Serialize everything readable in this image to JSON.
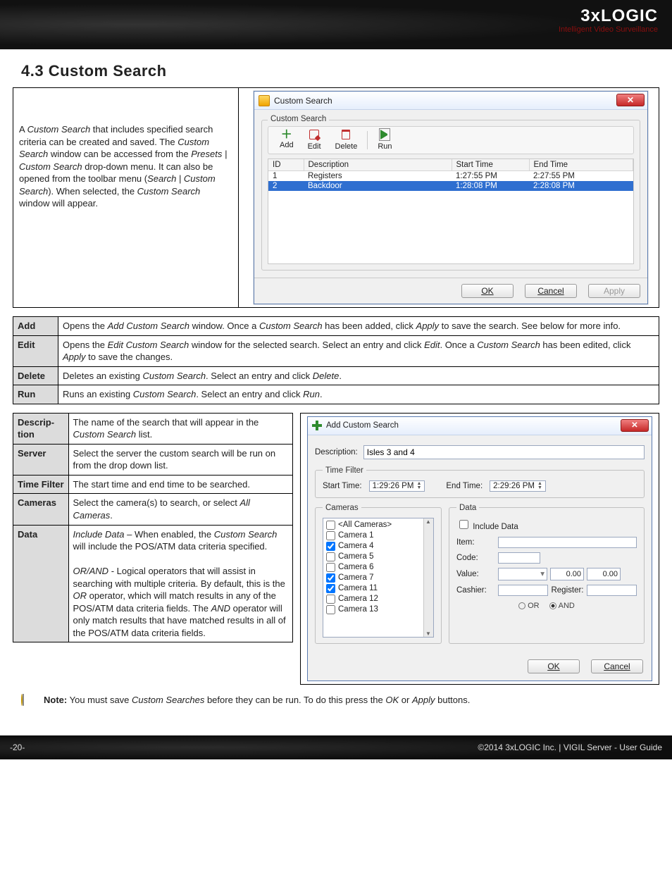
{
  "banner": {
    "logo_top": "3xLOGIC",
    "logo_sub": "Intelligent Video Surveillance"
  },
  "section_heading": "4.3 Custom Search",
  "intro_html": "A <em>Custom Search</em> that includes specified search criteria can be created and saved. The <em>Custom Search</em> window can be accessed from the <em>Presets | Custom Search</em> drop-down menu. It can also be opened from the toolbar menu (<em>Search | Custom Search</em>). When selected, the <em>Custom Search</em> window will appear.",
  "cs_dialog": {
    "title": "Custom Search",
    "group_title": "Custom Search",
    "toolbar": {
      "add": "Add",
      "edit": "Edit",
      "delete": "Delete",
      "run": "Run"
    },
    "grid": {
      "headers": {
        "id": "ID",
        "desc": "Description",
        "start": "Start Time",
        "end": "End Time"
      },
      "rows": [
        {
          "id": "1",
          "desc": "Registers",
          "start": "1:27:55 PM",
          "end": "2:27:55 PM",
          "selected": false
        },
        {
          "id": "2",
          "desc": "Backdoor",
          "start": "1:28:08 PM",
          "end": "2:28:08 PM",
          "selected": true
        }
      ]
    },
    "buttons": {
      "ok": "OK",
      "cancel": "Cancel",
      "apply": "Apply"
    }
  },
  "def1": [
    {
      "k": "Add",
      "v_html": "Opens the <em>Add Custom Search</em> window. Once a <em>Custom Search</em> has been added, click <em>Apply</em> to save the search. See below for more info."
    },
    {
      "k": "Edit",
      "v_html": "Opens the <em>Edit Custom Search</em> window for the selected search. Select an entry and click <em>Edit</em>. Once a <em>Custom Search</em> has been edited, click <em>Apply</em> to save the changes."
    },
    {
      "k": "Delete",
      "v_html": "Deletes an existing <em>Custom Search</em>. Select an entry and click <em>Delete</em>."
    },
    {
      "k": "Run",
      "v_html": "Runs an existing <em>Custom Search</em>. Select an entry and click <em>Run</em>."
    }
  ],
  "def2": [
    {
      "k": "Descrip-tion",
      "v_html": "The name of the search that will appear in the <em>Custom Search</em> list."
    },
    {
      "k": "Server",
      "v_html": "Select the server the custom search will be run on from the drop down list."
    },
    {
      "k": "Time Filter",
      "v_html": "The start time and end time to be searched."
    },
    {
      "k": "Cameras",
      "v_html": "Select the camera(s) to search, or select <em>All Cameras</em>."
    },
    {
      "k": "Data",
      "v_html": "<em>Include Data</em> – When enabled, the <em>Custom Search</em> will include the POS/ATM data criteria specified.<br><br><em>OR/AND</em> - Logical operators that will assist in searching with multiple criteria. By default, this is the <em>OR</em> operator, which will match results in any of the POS/ATM data criteria fields. The <em>AND</em> operator will only match results that have matched results in all of the POS/ATM data criteria fields."
    }
  ],
  "acs": {
    "title": "Add Custom Search",
    "desc_label": "Description:",
    "desc_value": "Isles 3 and 4",
    "timefilter": {
      "legend": "Time Filter",
      "start_label": "Start Time:",
      "start_val": "1:29:26 PM",
      "end_label": "End Time:",
      "end_val": "2:29:26 PM"
    },
    "cameras": {
      "legend": "Cameras",
      "items": [
        {
          "label": "<All Cameras>",
          "checked": false
        },
        {
          "label": "Camera 1",
          "checked": false
        },
        {
          "label": "Camera 4",
          "checked": true
        },
        {
          "label": "Camera 5",
          "checked": false
        },
        {
          "label": "Camera 6",
          "checked": false
        },
        {
          "label": "Camera 7",
          "checked": true
        },
        {
          "label": "Camera 11",
          "checked": true
        },
        {
          "label": "Camera 12",
          "checked": false
        },
        {
          "label": "Camera 13",
          "checked": false
        }
      ]
    },
    "data": {
      "legend": "Data",
      "include_label": "Include Data",
      "include_checked": false,
      "item_label": "Item:",
      "item_val": "",
      "code_label": "Code:",
      "code_val": "",
      "value_label": "Value:",
      "value_lo": "0.00",
      "value_hi": "0.00",
      "cashier_label": "Cashier:",
      "cashier_val": "",
      "register_label": "Register:",
      "register_val": "",
      "or_label": "OR",
      "and_label": "AND",
      "selected": "AND"
    },
    "buttons": {
      "ok": "OK",
      "cancel": "Cancel"
    }
  },
  "note": {
    "prefix": "Note:",
    "text_html": " You must save <em>Custom Searches</em> before they can be run.  To do this press the <em>OK</em> or <em>Apply</em> buttons."
  },
  "footer": {
    "page": "-20-",
    "right": "©2014 3xLOGIC Inc.  |  VIGIL Server - User Guide"
  }
}
